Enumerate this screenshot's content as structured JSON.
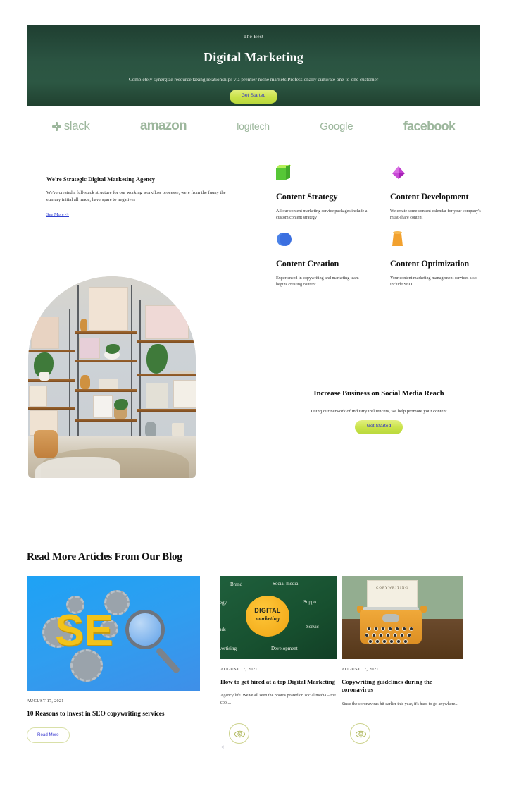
{
  "hero": {
    "eyebrow": "The Best",
    "title": "Digital Marketing",
    "subtitle": "Completely synergize resource taxing relationships via premier niche markets.Professionally cultivate one-to-one customer",
    "cta_label": "Get Started"
  },
  "logos": [
    {
      "name": "slack",
      "label": "slack"
    },
    {
      "name": "amazon",
      "label": "amazon"
    },
    {
      "name": "logitech",
      "label": "logitech"
    },
    {
      "name": "google",
      "label": "Google"
    },
    {
      "name": "facebook",
      "label": "facebook"
    }
  ],
  "about": {
    "title": "We're Strategic Digital Marketing Agency",
    "body": "We've created a full-stack structure for our working workflow processe, were from the fuuny the euntury initial all made, have spare to negatives",
    "link_label": "See More ->"
  },
  "services": [
    {
      "icon": "cube-icon",
      "title": "Content Strategy",
      "desc": "All our content marketing service packages include a custom content strategy"
    },
    {
      "icon": "octahedron-icon",
      "title": "Content Development",
      "desc": "We create some content calendar for your company's must-share content"
    },
    {
      "icon": "sphere-icon",
      "title": "Content Creation",
      "desc": "Experienced in copywriting and marketing team begins creating content"
    },
    {
      "icon": "cylinder-icon",
      "title": "Content Optimization",
      "desc": "Your content marketing management services also include SEO"
    }
  ],
  "promo": {
    "title": "Increase Business on Social Media Reach",
    "subtitle": "Using our network of industry influencers, we help promote your content",
    "cta_label": "Get Started"
  },
  "blog": {
    "heading": "Read More Articles From Our Blog",
    "prev_arrow": "<",
    "cards": [
      {
        "image": "seo-gears-magnifier-image",
        "date": "AUGUST 17, 2021",
        "title": "10 Reasons to invest in SEO copywriting services",
        "excerpt": "",
        "action_label": "Read More"
      },
      {
        "image": "digital-marketing-chalkboard-image",
        "date": "AUGUST 17, 2021",
        "title": "How to get hired at a top Digital Marketing",
        "excerpt": "Agency life. We've all seen the photos posted on social media – the cool...",
        "action_label": ""
      },
      {
        "image": "copywriting-typewriter-image",
        "date": "AUGUST 17, 2021",
        "title": "Copywriting guidelines during the coronavirus",
        "excerpt": "Since the coronavirus hit earlier this year, it's hard to go anywhere...",
        "action_label": ""
      }
    ]
  },
  "thumb_text": {
    "seo_letters": "SE",
    "chalk_main": "DIGITAL",
    "chalk_sub": "marketing",
    "chalk_words": [
      "Brand",
      "Social media",
      "tegy",
      "Suppo",
      "nds",
      "Servic",
      "dvertising",
      "Development"
    ],
    "typewriter_title": "COPYWRITING"
  },
  "colors": {
    "hero_green": "#2b5442",
    "cta_green": "#c9e249",
    "cta_text_blue": "#2f2fc8",
    "logo_gray_green": "#9db79d",
    "link_blue": "#2f3fd0",
    "eye_border": "#cdd38e"
  }
}
